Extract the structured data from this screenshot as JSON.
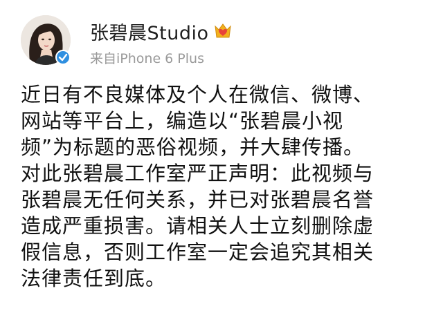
{
  "post": {
    "author": "张碧晨Studio",
    "source": "来自iPhone 6 Plus",
    "body_lines": [
      "近日有不良媒体及个人在微信、微博、",
      "网站等平台上，编造以“张碧晨小视",
      "频”为标题的恶俗视频，并大肆传播。",
      "对此张碧晨工作室严正声明：此视频与",
      "张碧晨无任何关系，并已对张碧晨名誉",
      "造成严重损害。请相关人士立刻删除虚",
      "假信息，否则工作室一定会追究其相关",
      "法律责任到底。"
    ]
  },
  "icons": {
    "avatar": "avatar-photo",
    "verified": "verified-check-icon",
    "vip": "crown-heart-icon"
  },
  "colors": {
    "verified_blue": "#2f8fe0",
    "vip_gold": "#f2b01e",
    "vip_red": "#e8423a",
    "text": "#111111",
    "source_gray": "#9a9a9a"
  }
}
